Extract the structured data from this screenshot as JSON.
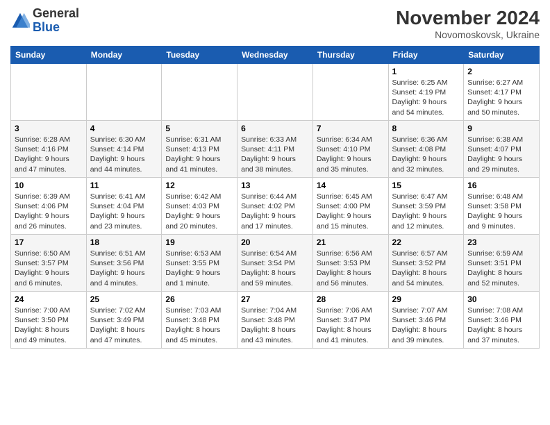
{
  "header": {
    "logo_general": "General",
    "logo_blue": "Blue",
    "month_year": "November 2024",
    "location": "Novomoskovsk, Ukraine"
  },
  "weekdays": [
    "Sunday",
    "Monday",
    "Tuesday",
    "Wednesday",
    "Thursday",
    "Friday",
    "Saturday"
  ],
  "weeks": [
    [
      {
        "day": "",
        "info": ""
      },
      {
        "day": "",
        "info": ""
      },
      {
        "day": "",
        "info": ""
      },
      {
        "day": "",
        "info": ""
      },
      {
        "day": "",
        "info": ""
      },
      {
        "day": "1",
        "info": "Sunrise: 6:25 AM\nSunset: 4:19 PM\nDaylight: 9 hours\nand 54 minutes."
      },
      {
        "day": "2",
        "info": "Sunrise: 6:27 AM\nSunset: 4:17 PM\nDaylight: 9 hours\nand 50 minutes."
      }
    ],
    [
      {
        "day": "3",
        "info": "Sunrise: 6:28 AM\nSunset: 4:16 PM\nDaylight: 9 hours\nand 47 minutes."
      },
      {
        "day": "4",
        "info": "Sunrise: 6:30 AM\nSunset: 4:14 PM\nDaylight: 9 hours\nand 44 minutes."
      },
      {
        "day": "5",
        "info": "Sunrise: 6:31 AM\nSunset: 4:13 PM\nDaylight: 9 hours\nand 41 minutes."
      },
      {
        "day": "6",
        "info": "Sunrise: 6:33 AM\nSunset: 4:11 PM\nDaylight: 9 hours\nand 38 minutes."
      },
      {
        "day": "7",
        "info": "Sunrise: 6:34 AM\nSunset: 4:10 PM\nDaylight: 9 hours\nand 35 minutes."
      },
      {
        "day": "8",
        "info": "Sunrise: 6:36 AM\nSunset: 4:08 PM\nDaylight: 9 hours\nand 32 minutes."
      },
      {
        "day": "9",
        "info": "Sunrise: 6:38 AM\nSunset: 4:07 PM\nDaylight: 9 hours\nand 29 minutes."
      }
    ],
    [
      {
        "day": "10",
        "info": "Sunrise: 6:39 AM\nSunset: 4:06 PM\nDaylight: 9 hours\nand 26 minutes."
      },
      {
        "day": "11",
        "info": "Sunrise: 6:41 AM\nSunset: 4:04 PM\nDaylight: 9 hours\nand 23 minutes."
      },
      {
        "day": "12",
        "info": "Sunrise: 6:42 AM\nSunset: 4:03 PM\nDaylight: 9 hours\nand 20 minutes."
      },
      {
        "day": "13",
        "info": "Sunrise: 6:44 AM\nSunset: 4:02 PM\nDaylight: 9 hours\nand 17 minutes."
      },
      {
        "day": "14",
        "info": "Sunrise: 6:45 AM\nSunset: 4:00 PM\nDaylight: 9 hours\nand 15 minutes."
      },
      {
        "day": "15",
        "info": "Sunrise: 6:47 AM\nSunset: 3:59 PM\nDaylight: 9 hours\nand 12 minutes."
      },
      {
        "day": "16",
        "info": "Sunrise: 6:48 AM\nSunset: 3:58 PM\nDaylight: 9 hours\nand 9 minutes."
      }
    ],
    [
      {
        "day": "17",
        "info": "Sunrise: 6:50 AM\nSunset: 3:57 PM\nDaylight: 9 hours\nand 6 minutes."
      },
      {
        "day": "18",
        "info": "Sunrise: 6:51 AM\nSunset: 3:56 PM\nDaylight: 9 hours\nand 4 minutes."
      },
      {
        "day": "19",
        "info": "Sunrise: 6:53 AM\nSunset: 3:55 PM\nDaylight: 9 hours\nand 1 minute."
      },
      {
        "day": "20",
        "info": "Sunrise: 6:54 AM\nSunset: 3:54 PM\nDaylight: 8 hours\nand 59 minutes."
      },
      {
        "day": "21",
        "info": "Sunrise: 6:56 AM\nSunset: 3:53 PM\nDaylight: 8 hours\nand 56 minutes."
      },
      {
        "day": "22",
        "info": "Sunrise: 6:57 AM\nSunset: 3:52 PM\nDaylight: 8 hours\nand 54 minutes."
      },
      {
        "day": "23",
        "info": "Sunrise: 6:59 AM\nSunset: 3:51 PM\nDaylight: 8 hours\nand 52 minutes."
      }
    ],
    [
      {
        "day": "24",
        "info": "Sunrise: 7:00 AM\nSunset: 3:50 PM\nDaylight: 8 hours\nand 49 minutes."
      },
      {
        "day": "25",
        "info": "Sunrise: 7:02 AM\nSunset: 3:49 PM\nDaylight: 8 hours\nand 47 minutes."
      },
      {
        "day": "26",
        "info": "Sunrise: 7:03 AM\nSunset: 3:48 PM\nDaylight: 8 hours\nand 45 minutes."
      },
      {
        "day": "27",
        "info": "Sunrise: 7:04 AM\nSunset: 3:48 PM\nDaylight: 8 hours\nand 43 minutes."
      },
      {
        "day": "28",
        "info": "Sunrise: 7:06 AM\nSunset: 3:47 PM\nDaylight: 8 hours\nand 41 minutes."
      },
      {
        "day": "29",
        "info": "Sunrise: 7:07 AM\nSunset: 3:46 PM\nDaylight: 8 hours\nand 39 minutes."
      },
      {
        "day": "30",
        "info": "Sunrise: 7:08 AM\nSunset: 3:46 PM\nDaylight: 8 hours\nand 37 minutes."
      }
    ]
  ]
}
